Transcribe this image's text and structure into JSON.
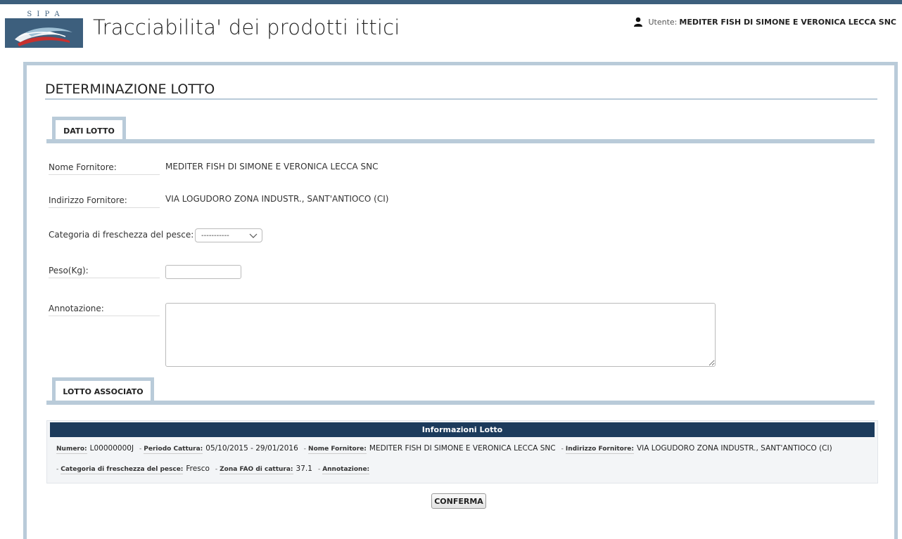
{
  "header": {
    "logo_text": "S I P A",
    "app_title": "Tracciabilita' dei prodotti ittici",
    "user_label": "Utente:",
    "user_name": "MEDITER FISH DI SIMONE E VERONICA LECCA SNC"
  },
  "page": {
    "title": "DETERMINAZIONE LOTTO"
  },
  "dati_lotto": {
    "tab_label": "DATI LOTTO",
    "nome_fornitore_label": "Nome Fornitore:",
    "nome_fornitore_value": "MEDITER FISH DI SIMONE E VERONICA LECCA SNC",
    "indirizzo_label": "Indirizzo Fornitore:",
    "indirizzo_value": "VIA LOGUDORO ZONA INDUSTR., SANT'ANTIOCO (CI)",
    "categoria_label": "Categoria di freschezza del pesce:",
    "categoria_selected": "-----------",
    "peso_label": "Peso(Kg):",
    "peso_value": "",
    "annotazione_label": "Annotazione:",
    "annotazione_value": ""
  },
  "lotto_associato": {
    "tab_label": "LOTTO ASSOCIATO",
    "header": "Informazioni Lotto",
    "numero_label": "Numero:",
    "numero_value": "L00000000J",
    "periodo_label": "Periodo Cattura:",
    "periodo_value": "05/10/2015 - 29/01/2016",
    "fornitore_label": "Nome Fornitore:",
    "fornitore_value": "MEDITER FISH DI SIMONE E VERONICA LECCA SNC",
    "indirizzo_label": "Indirizzo Fornitore:",
    "indirizzo_value": "VIA LOGUDORO ZONA INDUSTR., SANT'ANTIOCO (CI)",
    "categoria_label": "Categoria di freschezza del pesce:",
    "categoria_value": "Fresco",
    "zona_label": "Zona FAO di cattura:",
    "zona_value": "37.1",
    "annotazione_label": "Annotazione:",
    "annotazione_value": "",
    "separator": "-"
  },
  "actions": {
    "confirm_label": "CONFERMA"
  },
  "icons": {
    "user": "user-icon",
    "dropdown": "chevron-down-icon"
  },
  "colors": {
    "brand_dark": "#1c3b5c",
    "panel_border": "#b9cbd9",
    "logo_bg": "#3d5f7d"
  }
}
